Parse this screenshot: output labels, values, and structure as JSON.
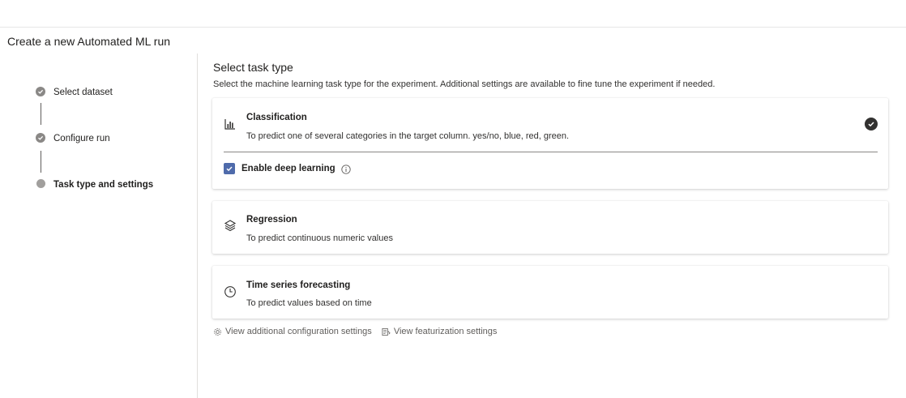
{
  "page": {
    "title": "Create a new Automated ML run"
  },
  "stepper": {
    "steps": [
      {
        "label": "Select dataset",
        "state": "completed"
      },
      {
        "label": "Configure run",
        "state": "completed"
      },
      {
        "label": "Task type and settings",
        "state": "current"
      }
    ]
  },
  "main": {
    "title": "Select task type",
    "description": "Select the machine learning task type for the experiment. Additional settings are available to fine tune the experiment if needed.",
    "tasks": [
      {
        "title": "Classification",
        "description": "To predict one of several categories in the target column. yes/no, blue, red, green.",
        "icon": "bar-chart-icon",
        "selected": true
      },
      {
        "title": "Regression",
        "description": "To predict continuous numeric values",
        "icon": "layers-icon",
        "selected": false
      },
      {
        "title": "Time series forecasting",
        "description": "To predict values based on time",
        "icon": "clock-icon",
        "selected": false
      }
    ],
    "deep_learning": {
      "label": "Enable deep learning",
      "checked": true
    }
  },
  "links": {
    "additional_config": "View additional configuration settings",
    "featurization": "View featurization settings"
  },
  "colors": {
    "accent": "#4f6bab",
    "step_dot": "#8a8886",
    "text": "#201f1e"
  }
}
